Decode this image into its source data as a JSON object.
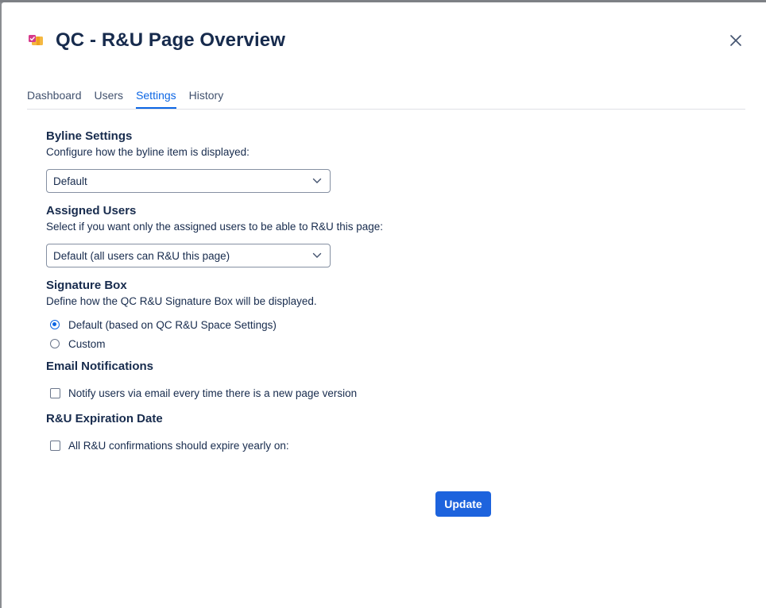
{
  "modal": {
    "title": "QC - R&U Page Overview",
    "close_icon": "close-icon",
    "app_icon": "app-logo-icon"
  },
  "tabs": [
    {
      "label": "Dashboard",
      "active": false
    },
    {
      "label": "Users",
      "active": false
    },
    {
      "label": "Settings",
      "active": true
    },
    {
      "label": "History",
      "active": false
    }
  ],
  "byline": {
    "title": "Byline Settings",
    "description": "Configure how the byline item is displayed:",
    "selected": "Default"
  },
  "assigned_users": {
    "title": "Assigned Users",
    "description": "Select if you want only the assigned users to be able to R&U this page:",
    "selected": "Default (all users can R&U this page)"
  },
  "signature_box": {
    "title": "Signature Box",
    "description": "Define how the QC R&U Signature Box will be displayed.",
    "options": [
      {
        "label": "Default (based on QC R&U Space Settings)",
        "checked": true
      },
      {
        "label": "Custom",
        "checked": false
      }
    ]
  },
  "email_notifications": {
    "title": "Email Notifications",
    "checkbox_label": "Notify users via email every time there is a new page version",
    "checked": false
  },
  "expiration": {
    "title": "R&U Expiration Date",
    "checkbox_label": "All R&U confirmations should expire yearly on:",
    "checked": false
  },
  "actions": {
    "update_label": "Update"
  },
  "colors": {
    "accent": "#0c66e4",
    "primary_button": "#1d63dd",
    "text": "#172b4d"
  }
}
